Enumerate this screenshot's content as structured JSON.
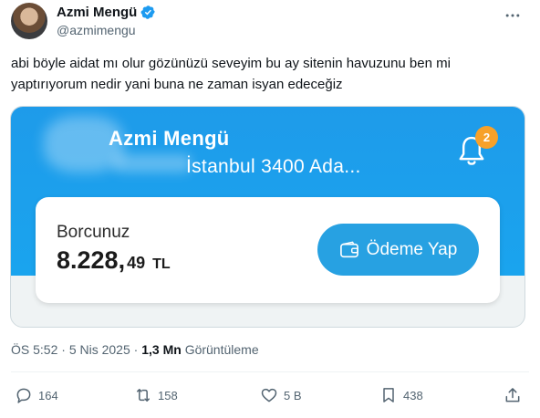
{
  "author": {
    "name": "Azmi Mengü",
    "handle": "@azmimengu"
  },
  "tweet": {
    "text": "abi böyle aidat mı olur gözünüzü seveyim bu ay sitenin havuzunu ben mi yaptırıyorum nedir yani buna ne zaman isyan edeceğiz"
  },
  "media": {
    "card_name": "Azmi Mengü",
    "card_address": "İstanbul 3400 Ada...",
    "notification_count": "2",
    "debt_label": "Borcunuz",
    "amount_main": "8.228,",
    "amount_cents": "49",
    "amount_currency": "TL",
    "pay_button": "Ödeme Yap"
  },
  "meta": {
    "time": "ÖS 5:52",
    "separator": "·",
    "date": "5 Nis 2025",
    "views_count": "1,3 Mn",
    "views_label": "Görüntüleme"
  },
  "actions": {
    "replies": "164",
    "retweets": "158",
    "likes": "5 B",
    "bookmarks": "438"
  },
  "colors": {
    "card_blue": "#1e9bea",
    "button_blue": "#27a1e2",
    "badge_orange": "#f7a12a",
    "verified_blue": "#1d9bf0"
  },
  "icons": [
    "verified-badge-icon",
    "more-icon",
    "bell-icon",
    "wallet-icon",
    "reply-icon",
    "retweet-icon",
    "like-icon",
    "bookmark-icon",
    "share-icon"
  ]
}
